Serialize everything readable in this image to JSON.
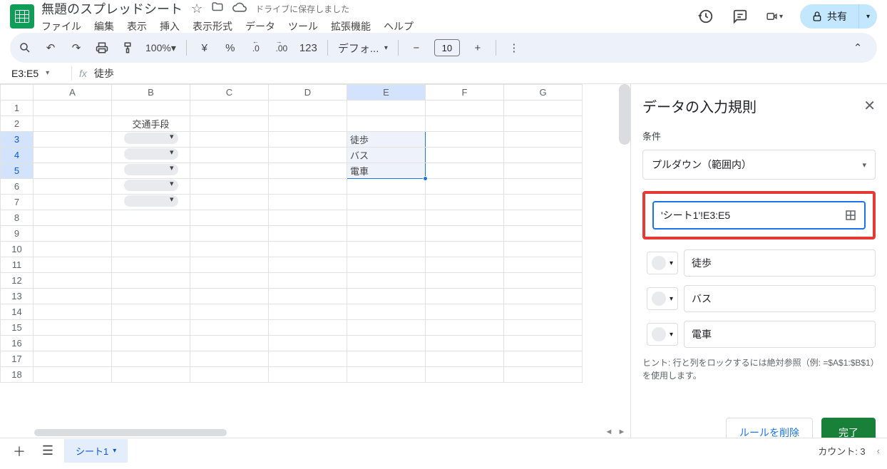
{
  "header": {
    "doc_title": "無題のスプレッドシート",
    "save_status": "ドライブに保存しました",
    "share_label": "共有"
  },
  "menus": [
    "ファイル",
    "編集",
    "表示",
    "挿入",
    "表示形式",
    "データ",
    "ツール",
    "拡張機能",
    "ヘルプ"
  ],
  "toolbar": {
    "zoom": "100%",
    "currency": "¥",
    "percent": "%",
    "dec_dec": ".0",
    "inc_dec": ".00",
    "numfmt": "123",
    "font": "デフォ...",
    "minus": "−",
    "font_size": "10",
    "plus": "+"
  },
  "formula_bar": {
    "name_box": "E3:E5",
    "value": "徒歩"
  },
  "columns": [
    "A",
    "B",
    "C",
    "D",
    "E",
    "F",
    "G"
  ],
  "rows": [
    "1",
    "2",
    "3",
    "4",
    "5",
    "6",
    "7",
    "8",
    "9",
    "10",
    "11",
    "12",
    "13",
    "14",
    "15",
    "16",
    "17",
    "18"
  ],
  "cells": {
    "B2": "交通手段",
    "E3": "徒歩",
    "E4": "バス",
    "E5": "電車"
  },
  "sidepanel": {
    "title": "データの入力規則",
    "criteria_label": "条件",
    "criteria_value": "プルダウン（範囲内）",
    "range_value": "'シート1'!E3:E5",
    "options": [
      "徒歩",
      "バス",
      "電車"
    ],
    "hint": "ヒント: 行と列をロックするには絶対参照（例: =$A$1:$B$1）を使用します。",
    "delete_label": "ルールを削除",
    "done_label": "完了"
  },
  "bottom": {
    "sheet_name": "シート1",
    "count_label": "カウント: 3"
  }
}
